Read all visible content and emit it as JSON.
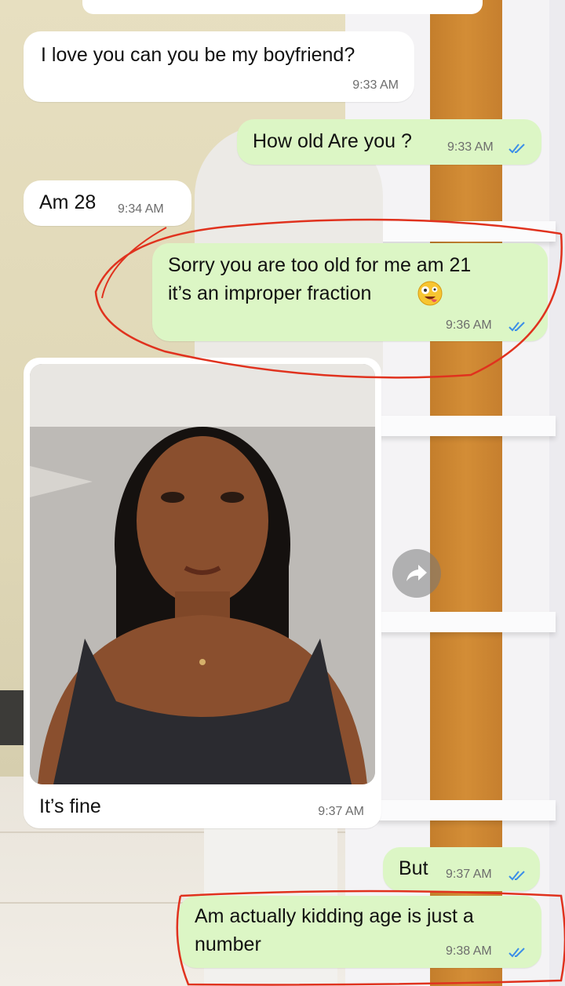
{
  "messages": [
    {
      "id": "m1",
      "side": "incoming",
      "text": "I love you can you be my boyfriend?",
      "time": "9:33 AM"
    },
    {
      "id": "m2",
      "side": "outgoing",
      "text": "How old Are you ?",
      "time": "9:33 AM",
      "status": "read"
    },
    {
      "id": "m3",
      "side": "incoming",
      "text": "Am 28",
      "time": "9:34 AM"
    },
    {
      "id": "m4",
      "side": "outgoing",
      "lines": [
        "Sorry you are too old for me am  21",
        "it’s an improper fraction"
      ],
      "emoji": "zany-face-emoji",
      "time": "9:36 AM",
      "status": "read"
    },
    {
      "id": "m5",
      "side": "incoming",
      "type": "photo",
      "caption": "It’s fine",
      "time": "9:37 AM"
    },
    {
      "id": "m6",
      "side": "outgoing",
      "text": "But",
      "time": "9:37 AM",
      "status": "read"
    },
    {
      "id": "m7",
      "side": "outgoing",
      "lines": [
        "Am actually kidding age is just a",
        "number"
      ],
      "time": "9:38 AM",
      "status": "read"
    }
  ],
  "icons": {
    "read_receipt": "double-check-icon",
    "forward": "forward-icon"
  },
  "colors": {
    "incoming_bubble": "#ffffff",
    "outgoing_bubble": "#dcf6c5",
    "read_tick": "#3b8ee8",
    "annotation_red": "#e0321e"
  }
}
